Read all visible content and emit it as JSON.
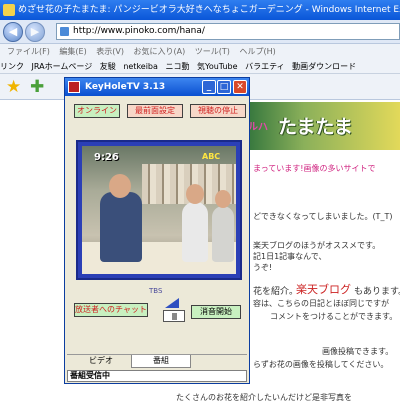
{
  "browser": {
    "title": "めざせ花の子たまたま: パンジービオラ大好きへなちょこガーデニング - Windows Internet Explorer",
    "url": "http://www.pinoko.com/hana/",
    "menu": [
      "ファイル(F)",
      "編集(E)",
      "表示(V)",
      "お気に入り(A)",
      "ツール(T)",
      "ヘルプ(H)"
    ],
    "links_label": "リンク",
    "links": [
      "JRAホームページ",
      "友駿",
      "netkeiba",
      "ニコ動",
      "気YouTube",
      "バラエティ",
      "動画ダウンロード"
    ]
  },
  "page": {
    "banner_small": "ルハ",
    "banner_title": "たまたま",
    "lines": [
      "まっています!画像の多いサイトで",
      "どできなくなってしまいました。(T_T)",
      "楽天ブログのほうがオススメです。",
      "記1日1記事なんで、",
      "うぞ!",
      "花を紹介。",
      "楽天ブログ",
      "もあります。",
      "容は、こちらの日記とほぼ同じですが",
      "コメントをつけることができます。",
      "画像投稿できます。",
      "らずお花の画像を投稿してください。",
      "たくさんのお花を紹介したいんだけど是非写真を"
    ]
  },
  "keyhole": {
    "title": "KeyHoleTV 3.13",
    "buttons": {
      "online": "オンライン",
      "topmost": "最前面設定",
      "stop": "視聴の停止",
      "chat": "放送者へのチャット",
      "mute": "消音開始"
    },
    "video_clock": "9:26",
    "video_logo": "ABC",
    "channel": "TBS",
    "tabs": [
      "ビデオ",
      "番組"
    ],
    "status": "番組受信中"
  }
}
